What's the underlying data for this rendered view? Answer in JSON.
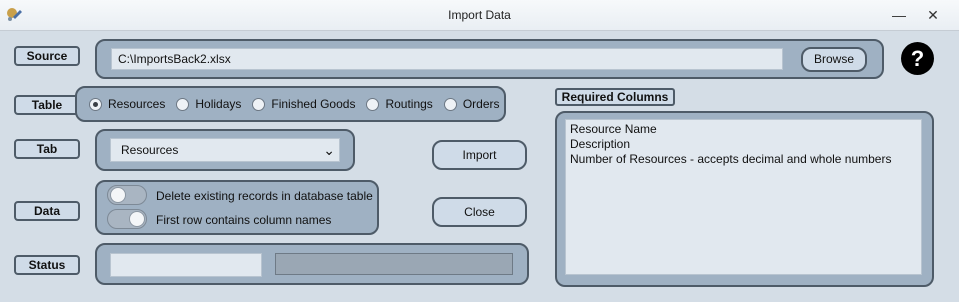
{
  "window": {
    "title": "Import Data",
    "controls": {
      "minimize": "—",
      "maximize": "□",
      "close": "✕"
    }
  },
  "labels": {
    "source": "Source",
    "table": "Table",
    "tab": "Tab",
    "data": "Data",
    "status": "Status"
  },
  "source": {
    "path": "C:\\ImportsBack2.xlsx",
    "browse_label": "Browse"
  },
  "help_label": "?",
  "table_options": {
    "selected": "Resources",
    "items": [
      "Resources",
      "Holidays",
      "Finished Goods",
      "Routings",
      "Orders"
    ]
  },
  "tab": {
    "selected": "Resources",
    "chevron": "⌄"
  },
  "actions": {
    "import_label": "Import",
    "close_label": "Close"
  },
  "data_options": {
    "delete_existing": {
      "label": "Delete existing records in database table",
      "on": false
    },
    "first_row_headers": {
      "label": "First row contains column names",
      "on": true
    }
  },
  "status": {
    "text": "",
    "progress": 0
  },
  "required_columns": {
    "title": "Required Columns",
    "lines": [
      "Resource Name",
      "Description",
      "Number of Resources - accepts decimal and whole numbers"
    ]
  },
  "colors": {
    "panel_bg": "#9fb1c3",
    "panel_border": "#4e5b68",
    "window_bg": "#d4dde6",
    "label_bg": "#cfdbe8"
  }
}
